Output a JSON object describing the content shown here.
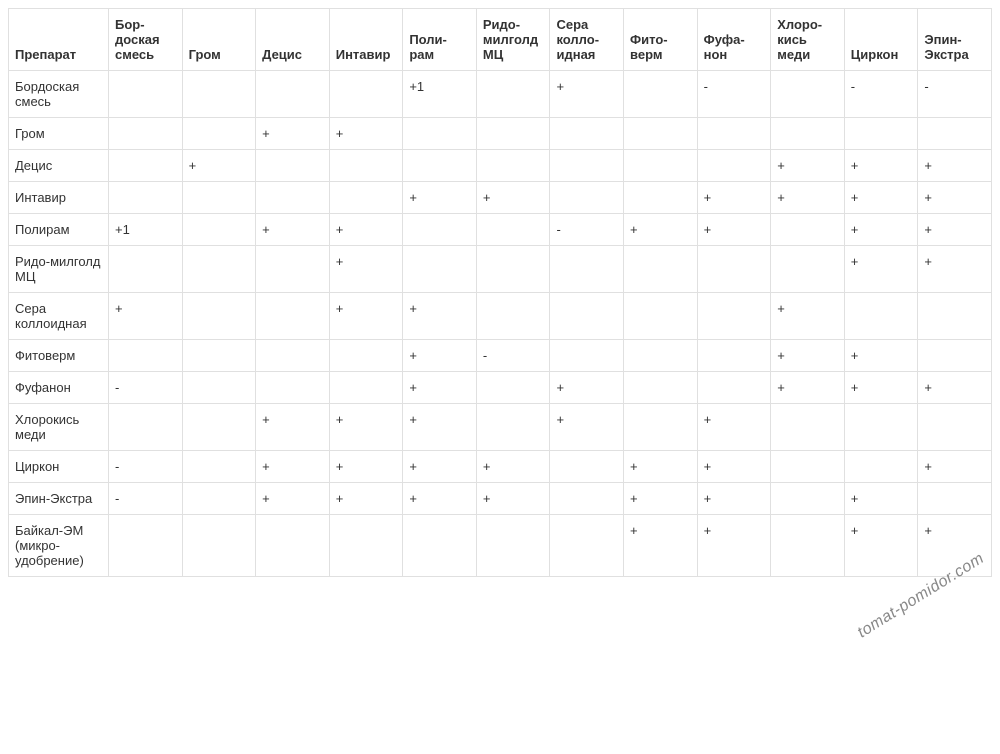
{
  "watermark": "tomat-pomidor.com",
  "table": {
    "headers": [
      "Препарат",
      "Бор-доская смесь",
      "Гром",
      "Децис",
      "Интавир",
      "Поли-рам",
      "Ридо-милголд МЦ",
      "Сера колло-идная",
      "Фито-верм",
      "Фуфа-нон",
      "Хлоро-кись меди",
      "Циркон",
      "Эпин-Экстра"
    ],
    "rows": [
      {
        "label": "Бордоская смесь",
        "cells": [
          "",
          "",
          "",
          "",
          "+1",
          "",
          "+",
          "",
          "-",
          "",
          "-",
          "-"
        ]
      },
      {
        "label": "Гром",
        "cells": [
          "",
          "",
          "+",
          "+",
          "",
          "",
          "",
          "",
          "",
          "",
          "",
          ""
        ]
      },
      {
        "label": "Децис",
        "cells": [
          "",
          "+",
          "",
          "",
          "",
          "",
          "",
          "",
          "",
          "+",
          "+",
          "+"
        ]
      },
      {
        "label": "Интавир",
        "cells": [
          "",
          "",
          "",
          "",
          "+",
          "+",
          "",
          "",
          "+",
          "+",
          "+",
          "+"
        ]
      },
      {
        "label": "Полирам",
        "cells": [
          "+1",
          "",
          "+",
          "+",
          "",
          "",
          "-",
          "+",
          "+",
          "",
          "+",
          "+"
        ]
      },
      {
        "label": "Ридо-милголд МЦ",
        "cells": [
          "",
          "",
          "",
          "+",
          "",
          "",
          "",
          "",
          "",
          "",
          "+",
          "+"
        ]
      },
      {
        "label": "Сера коллоидная",
        "cells": [
          "+",
          "",
          "",
          "+",
          "+",
          "",
          "",
          "",
          "",
          "+",
          "",
          ""
        ]
      },
      {
        "label": "Фитоверм",
        "cells": [
          "",
          "",
          "",
          "",
          "+",
          "-",
          "",
          "",
          "",
          "+",
          "+",
          ""
        ]
      },
      {
        "label": "Фуфанон",
        "cells": [
          "-",
          "",
          "",
          "",
          "+",
          "",
          "+",
          "",
          "",
          "+",
          "+",
          "+"
        ]
      },
      {
        "label": "Хлорокись меди",
        "cells": [
          "",
          "",
          "+",
          "+",
          "+",
          "",
          "+",
          "",
          "+",
          "",
          "",
          ""
        ]
      },
      {
        "label": "Циркон",
        "cells": [
          "-",
          "",
          "+",
          "+",
          "+",
          "+",
          "",
          "+",
          "+",
          "",
          "",
          "+"
        ]
      },
      {
        "label": "Эпин-Экстра",
        "cells": [
          "-",
          "",
          "+",
          "+",
          "+",
          "+",
          "",
          "+",
          "+",
          "",
          "+",
          ""
        ]
      },
      {
        "label": "Байкал-ЭМ (микро-удобрение)",
        "cells": [
          "",
          "",
          "",
          "",
          "",
          "",
          "",
          "+",
          "+",
          "",
          "+",
          "+"
        ]
      }
    ]
  }
}
